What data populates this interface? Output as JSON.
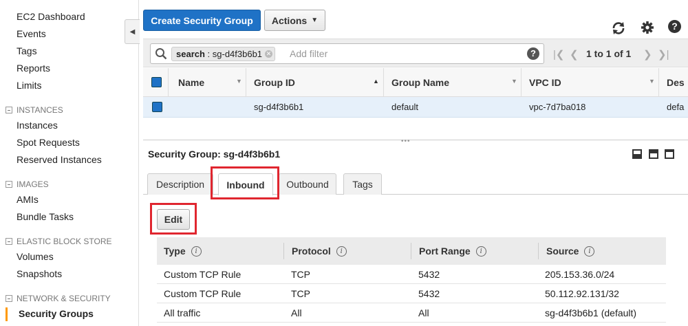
{
  "sidebar": {
    "top_links": [
      "EC2 Dashboard",
      "Events",
      "Tags",
      "Reports",
      "Limits"
    ],
    "instances": {
      "header": "INSTANCES",
      "items": [
        "Instances",
        "Spot Requests",
        "Reserved Instances"
      ]
    },
    "images": {
      "header": "IMAGES",
      "items": [
        "AMIs",
        "Bundle Tasks"
      ]
    },
    "ebs": {
      "header": "ELASTIC BLOCK STORE",
      "items": [
        "Volumes",
        "Snapshots"
      ]
    },
    "netsec": {
      "header": "NETWORK & SECURITY",
      "items": [
        "Security Groups"
      ]
    },
    "accent_color": "#ff9900"
  },
  "toolbar": {
    "create_label": "Create Security Group",
    "actions_label": "Actions",
    "icons": [
      "refresh-icon",
      "gear-icon",
      "help-icon"
    ]
  },
  "filter": {
    "tag_key": "search",
    "tag_value": " : sg-d4f3b6b1",
    "placeholder": "Add filter",
    "pagination": "1 to 1 of 1"
  },
  "table": {
    "columns": [
      "Name",
      "Group ID",
      "Group Name",
      "VPC ID",
      "Des"
    ],
    "rows": [
      {
        "name": "",
        "group_id": "sg-d4f3b6b1",
        "group_name": "default",
        "vpc_id": "vpc-7d7ba018",
        "description": "defa"
      }
    ]
  },
  "details": {
    "title": "Security Group: sg-d4f3b6b1",
    "tabs": [
      "Description",
      "Inbound",
      "Outbound",
      "Tags"
    ],
    "active_tab": "Inbound",
    "edit_label": "Edit",
    "rules_columns": [
      "Type",
      "Protocol",
      "Port Range",
      "Source"
    ],
    "rules": [
      {
        "type": "Custom TCP Rule",
        "protocol": "TCP",
        "port": "5432",
        "source": "205.153.36.0/24"
      },
      {
        "type": "Custom TCP Rule",
        "protocol": "TCP",
        "port": "5432",
        "source": "50.112.92.131/32"
      },
      {
        "type": "All traffic",
        "protocol": "All",
        "port": "All",
        "source": "sg-d4f3b6b1 (default)"
      }
    ]
  },
  "colors": {
    "primary": "#1f72c6",
    "highlight": "#e0262f",
    "selected_row": "#e6f0fa"
  }
}
